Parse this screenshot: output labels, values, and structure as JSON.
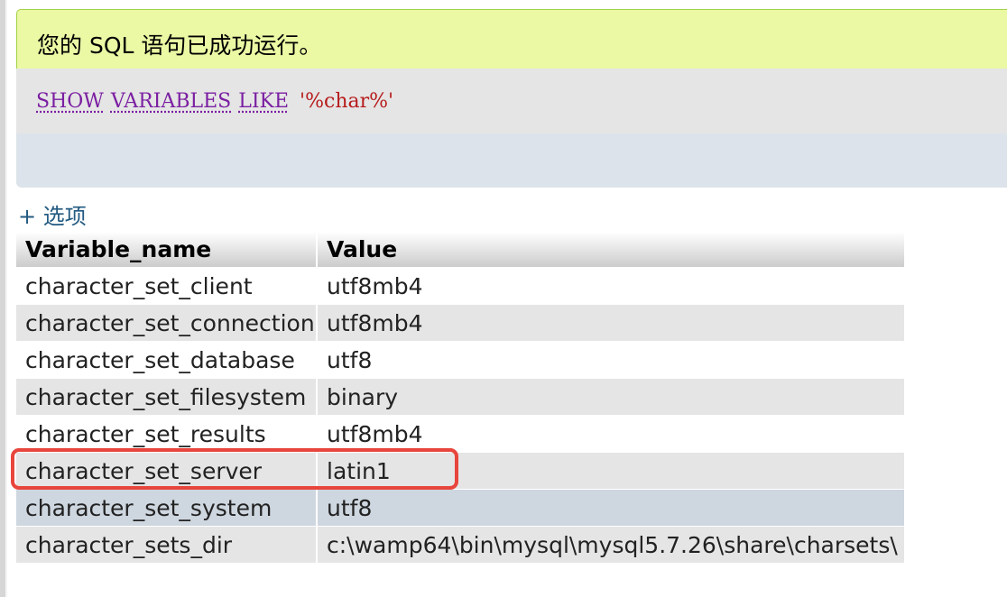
{
  "message": {
    "success_text": "您的 SQL 语句已成功运行。",
    "status_color": "#ebf8a4"
  },
  "query": {
    "keywords": [
      "SHOW",
      "VARIABLES",
      "LIKE"
    ],
    "pattern": "'%char%'"
  },
  "options": {
    "label": "+ 选项"
  },
  "table": {
    "columns": [
      "Variable_name",
      "Value"
    ],
    "rows": [
      {
        "name": "character_set_client",
        "value": "utf8mb4"
      },
      {
        "name": "character_set_connection",
        "value": "utf8mb4"
      },
      {
        "name": "character_set_database",
        "value": "utf8"
      },
      {
        "name": "character_set_filesystem",
        "value": "binary"
      },
      {
        "name": "character_set_results",
        "value": "utf8mb4"
      },
      {
        "name": "character_set_server",
        "value": "latin1"
      },
      {
        "name": "character_set_system",
        "value": "utf8"
      },
      {
        "name": "character_sets_dir",
        "value": "c:\\wamp64\\bin\\mysql\\mysql5.7.26\\share\\charsets\\"
      }
    ],
    "hovered_row": "character_set_system",
    "highlighted_row": "character_set_server",
    "highlight_color": "#e8453c"
  }
}
